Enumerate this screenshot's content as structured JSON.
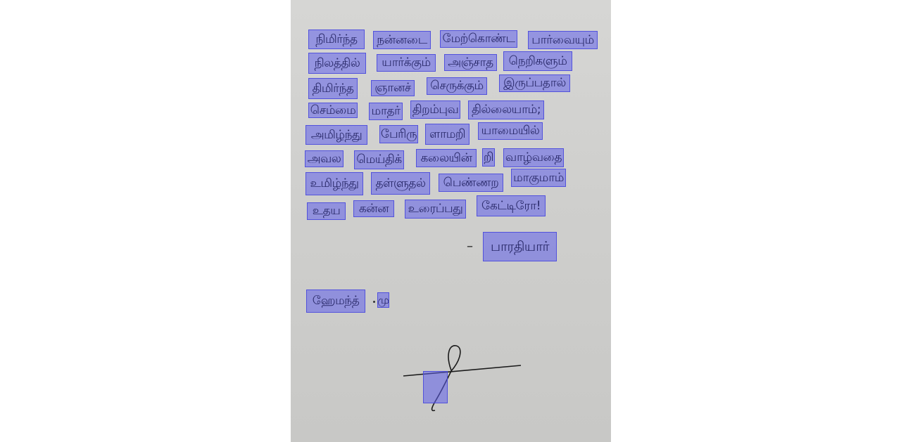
{
  "poem": {
    "lines": [
      [
        "நிமிர்ந்த",
        "நன்னடை",
        "மேற்கொண்ட",
        "பார்வையும்"
      ],
      [
        "நிலத்தில்",
        "யார்க்கும்",
        "அஞ்சாத",
        "நெறிகளும்"
      ],
      [
        "திமிர்ந்த",
        "ஞானச்",
        "செருக்கும்",
        "இருப்பதால்"
      ],
      [
        "செம்மை",
        "மாதர்",
        "திறம்புவ",
        "தில்லையாம்;"
      ],
      [
        "அமிழ்ந்து",
        "பேரிரு",
        "ளாமறி",
        "யாமையில்"
      ],
      [
        "அவல",
        "மெய்திக்",
        "கலையின்",
        "றி",
        "வாழ்வதை"
      ],
      [
        "உமிழ்ந்து",
        "தள்ளுதல்",
        "பெண்ணற",
        "மாகுமாம்"
      ],
      [
        "உதய",
        "கன்ன",
        "உரைப்பது",
        "கேட்டிரோ!"
      ]
    ]
  },
  "attribution": {
    "dash": "–",
    "author": "பாரதியார்"
  },
  "signoff": {
    "name": "ஹேமந்த்",
    "initial": "மு"
  },
  "colors": {
    "highlight": "#5f5feb",
    "paper": "#d0d0ce",
    "ink": "#1a1a1a"
  }
}
